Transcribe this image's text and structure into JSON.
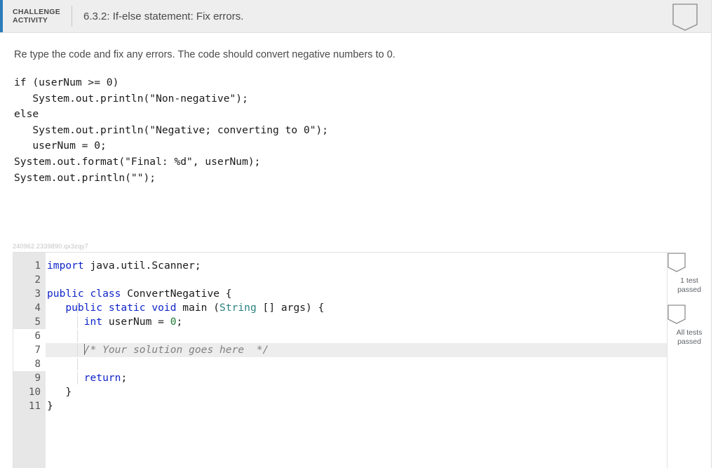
{
  "header": {
    "kicker": "CHALLENGE ACTIVITY",
    "title": "6.3.2: If-else statement: Fix errors.",
    "bookmark_icon": "bookmark-icon"
  },
  "prompt": {
    "instruction": "Re type the code and fix any errors. The code should convert negative numbers to 0.",
    "code": "if (userNum >= 0)\n   System.out.println(\"Non-negative\");\nelse\n   System.out.println(\"Negative; converting to 0\");\n   userNum = 0;\nSystem.out.format(\"Final: %d\", userNum);\nSystem.out.println(\"\");"
  },
  "editor": {
    "watermark": "240962.2339890.qx3zqy7",
    "lines": [
      {
        "no": "1",
        "editable": false,
        "active": false,
        "tokens": [
          {
            "t": "import",
            "c": "kw"
          },
          {
            "t": " java.util.Scanner;",
            "c": "plain"
          }
        ]
      },
      {
        "no": "2",
        "editable": false,
        "active": false,
        "tokens": []
      },
      {
        "no": "3",
        "editable": false,
        "active": false,
        "tokens": [
          {
            "t": "public class",
            "c": "kw"
          },
          {
            "t": " ConvertNegative {",
            "c": "plain"
          }
        ]
      },
      {
        "no": "4",
        "editable": false,
        "active": false,
        "tokens": [
          {
            "t": "   public static void",
            "c": "kw"
          },
          {
            "t": " main (",
            "c": "plain"
          },
          {
            "t": "String",
            "c": "type"
          },
          {
            "t": " [] args) {",
            "c": "plain"
          }
        ]
      },
      {
        "no": "5",
        "editable": false,
        "active": false,
        "tokens": [
          {
            "t": "      int",
            "c": "kw"
          },
          {
            "t": " userNum = ",
            "c": "plain"
          },
          {
            "t": "0",
            "c": "num"
          },
          {
            "t": ";",
            "c": "plain"
          }
        ]
      },
      {
        "no": "6",
        "editable": true,
        "active": false,
        "tokens": []
      },
      {
        "no": "7",
        "editable": true,
        "active": true,
        "caret": true,
        "tokens": [
          {
            "t": "      ",
            "c": "plain"
          },
          {
            "t": "/* Your solution goes here  */",
            "c": "comment"
          }
        ]
      },
      {
        "no": "8",
        "editable": true,
        "active": false,
        "tokens": []
      },
      {
        "no": "9",
        "editable": false,
        "active": false,
        "tokens": [
          {
            "t": "      ",
            "c": "plain"
          },
          {
            "t": "return",
            "c": "kw"
          },
          {
            "t": ";",
            "c": "plain"
          }
        ]
      },
      {
        "no": "10",
        "editable": false,
        "active": false,
        "tokens": [
          {
            "t": "   }",
            "c": "plain"
          }
        ]
      },
      {
        "no": "11",
        "editable": false,
        "active": false,
        "tokens": [
          {
            "t": "}",
            "c": "plain"
          }
        ]
      }
    ]
  },
  "test_rail": {
    "items": [
      {
        "icon": "bookmark-icon",
        "label": "1 test passed"
      },
      {
        "icon": "bookmark-icon",
        "label": "All tests passed"
      }
    ]
  },
  "colors": {
    "accent_bar": "#2b7cb8",
    "header_bg": "#eeeeee",
    "gutter_bg": "#e7e7e7",
    "active_line_bg": "#ededed",
    "keyword": "#0f24c8",
    "type": "#2b8080",
    "number": "#1d7a33",
    "comment": "#808080"
  }
}
